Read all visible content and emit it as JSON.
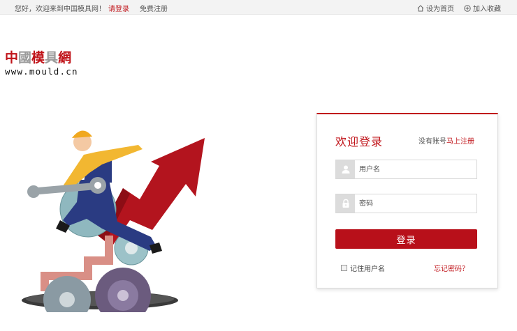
{
  "topbar": {
    "greeting": "您好，欢迎来到中国模具网！",
    "login_link": "请登录",
    "register_link": "免费注册",
    "set_home": "设为首页",
    "add_favorite": "加入收藏"
  },
  "logo": {
    "cn_red_1": "中",
    "cn_gray": "國",
    "cn_red_2": "模",
    "cn_gray_2": "具",
    "cn_red_3": "網",
    "domain": "www.mould.cn"
  },
  "login_card": {
    "title": "欢迎登录",
    "no_account_text": "没有账号",
    "register_now": "马上注册",
    "username_placeholder": "用户名",
    "password_placeholder": "密码",
    "login_button": "登录",
    "remember_label": "记住用户名",
    "forgot_link": "忘记密码？"
  },
  "colors": {
    "brand_red": "#c0141a",
    "button_red": "#b8101a",
    "topbar_bg": "#f3f3f3"
  }
}
